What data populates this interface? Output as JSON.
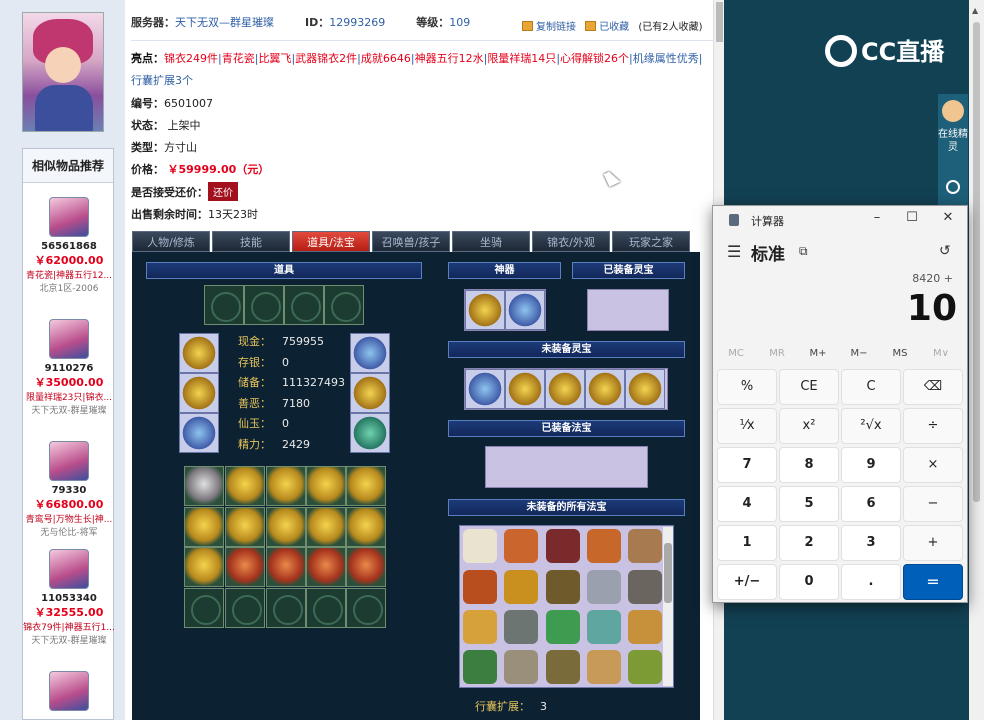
{
  "header": {
    "server_label": "服务器：",
    "server_value": "天下无双—群星璀璨",
    "id_label": "ID：",
    "id_value": "12993269",
    "level_label": "等级：",
    "level_value": "109",
    "copy_link": "复制链接",
    "favorited": "已收藏",
    "fav_count": "(已有2人收藏)"
  },
  "highlights": {
    "label": "亮点：",
    "items": [
      "锦衣249件",
      "青花瓷",
      "比翼飞",
      "武器锦衣2件",
      "成就6646",
      "神器五行12水",
      "限量祥瑞14只",
      "心得解锁26个",
      "机缘属性优秀",
      "行囊扩展3个"
    ]
  },
  "details": {
    "number_label": "编号：",
    "number_value": "6501007",
    "status_label": "状态：",
    "status_value": "上架中",
    "type_label": "类型：",
    "type_value": "方寸山",
    "price_label": "价格：",
    "price_value": "￥59999.00（元）",
    "bargain_label": "是否接受还价：",
    "bargain_button": "还价",
    "remain_label": "出售剩余时间：",
    "remain_value": "13天23时"
  },
  "similar": {
    "title": "相似物品推荐",
    "items": [
      {
        "id": "56561868",
        "price": "￥62000.00",
        "tags": "青花瓷|神器五行12...",
        "server": "北京1区-2006"
      },
      {
        "id": "9110276",
        "price": "￥35000.00",
        "tags": "限量祥瑞23只|锦衣...",
        "server": "天下无双-群星璀璨"
      },
      {
        "id": "79330",
        "price": "￥66800.00",
        "tags": "青鸾号|万物生长|神...",
        "server": "无与伦比-将军"
      },
      {
        "id": "11053340",
        "price": "￥32555.00",
        "tags": "锦衣79件|神器五行1...",
        "server": "天下无双-群星璀璨"
      }
    ]
  },
  "tabs": [
    "人物/修炼",
    "技能",
    "道具/法宝",
    "召唤兽/孩子",
    "坐骑",
    "锦衣/外观",
    "玩家之家"
  ],
  "active_tab": "道具/法宝",
  "sections": {
    "items": "道具",
    "artifact": "神器",
    "equipped_spirit": "已装备灵宝",
    "unequipped_spirit": "未装备灵宝",
    "equipped_fabao": "已装备法宝",
    "all_fabao": "未装备的所有法宝"
  },
  "stats": [
    {
      "k": "现金：",
      "v": "759955"
    },
    {
      "k": "存银：",
      "v": "0"
    },
    {
      "k": "储备：",
      "v": "111327493"
    },
    {
      "k": "善恶：",
      "v": "7180"
    },
    {
      "k": "仙玉：",
      "v": "0"
    },
    {
      "k": "精力：",
      "v": "2429"
    }
  ],
  "expand": {
    "label": "行囊扩展：",
    "value": "3"
  },
  "live": {
    "logo": "CC直播",
    "side_label": "在线精灵"
  },
  "calculator": {
    "title": "计算器",
    "mode": "标准",
    "expression": "8420 +",
    "display": "10",
    "memory": [
      "MC",
      "MR",
      "M+",
      "M−",
      "MS",
      "M∨"
    ],
    "keys": [
      "%",
      "CE",
      "C",
      "⌫",
      "⅟x",
      "x²",
      "²√x",
      "÷",
      "7",
      "8",
      "9",
      "×",
      "4",
      "5",
      "6",
      "−",
      "1",
      "2",
      "3",
      "+",
      "+/−",
      "0",
      ".",
      "="
    ]
  },
  "colors": {
    "accent_red": "#e4001b",
    "link_blue": "#2f5fa5",
    "calc_equals": "#005fb8",
    "live_bg": "#124153"
  }
}
